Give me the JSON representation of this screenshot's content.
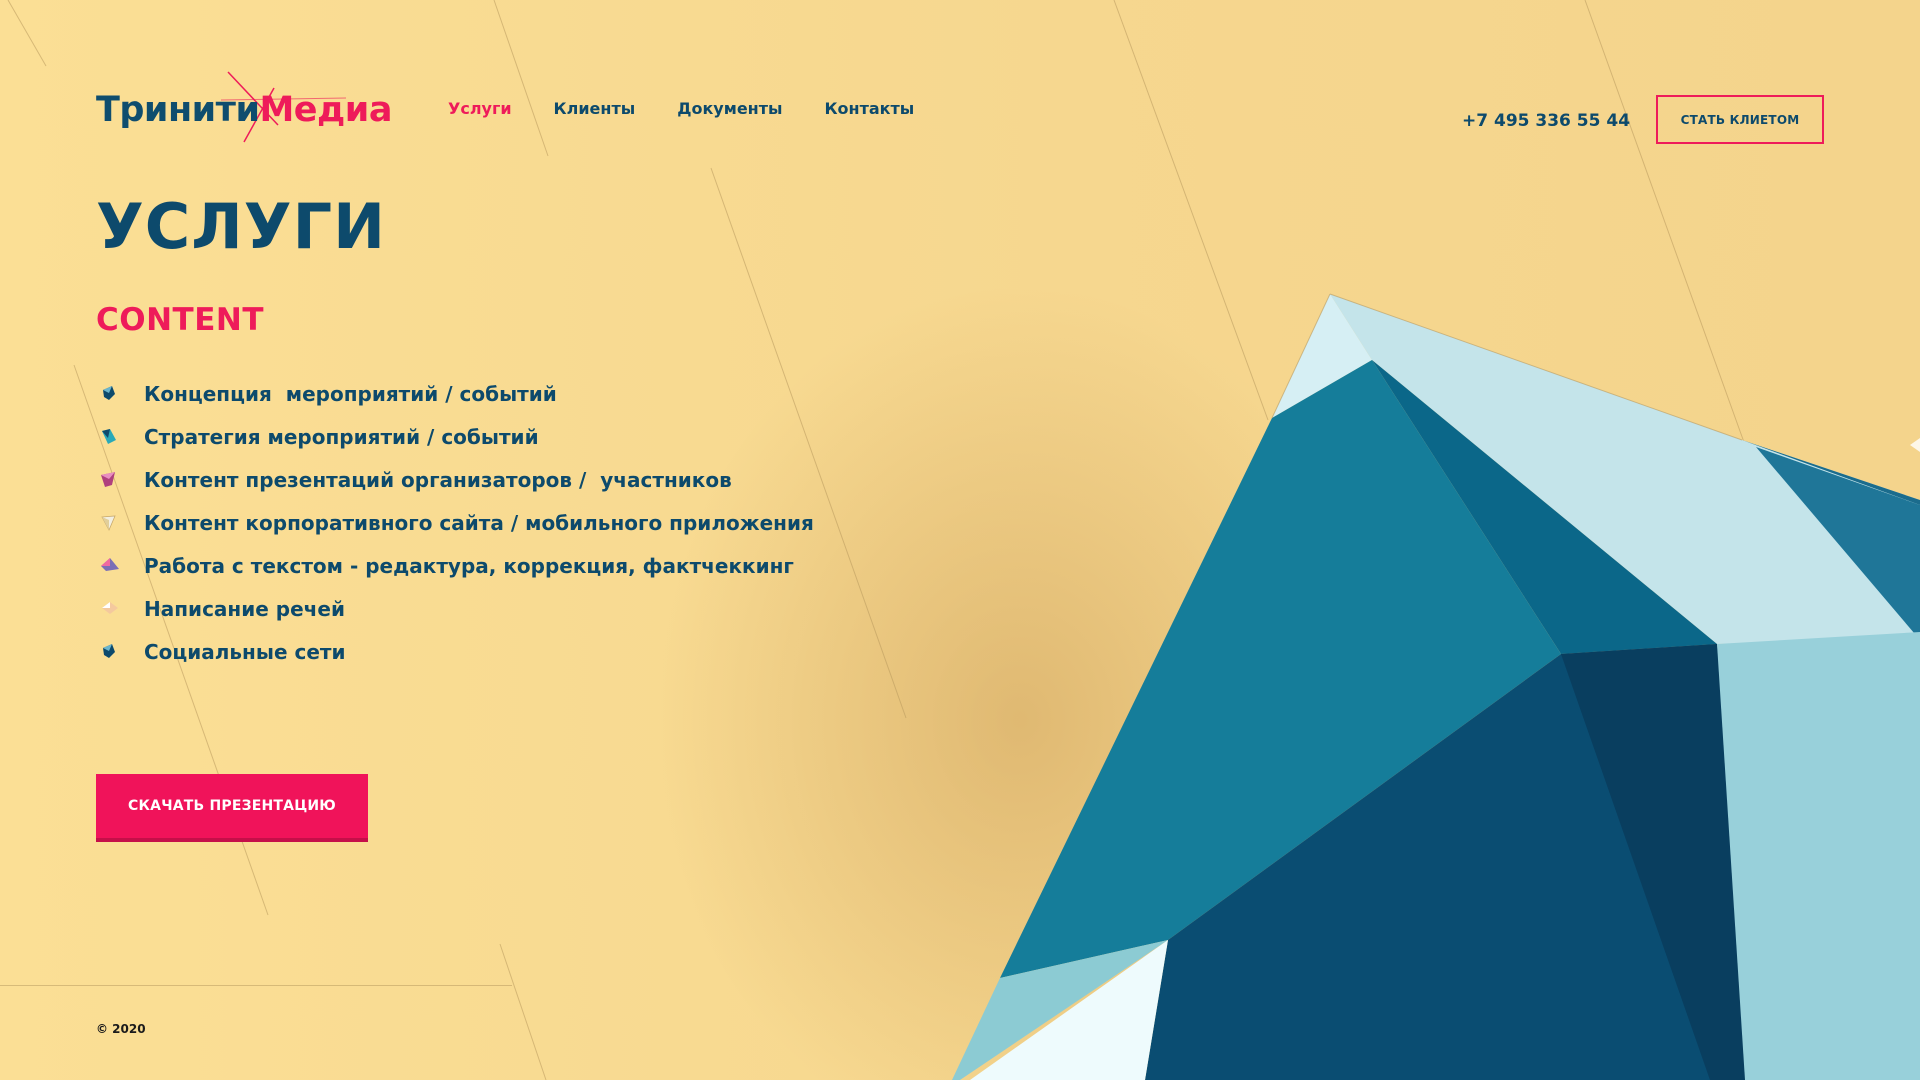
{
  "brand": {
    "name_part1": "Тринити",
    "name_part2": "Медиа",
    "primary_color": "#0d4a6c",
    "accent_color": "#ee1b5a",
    "background_color": "#f9dc93"
  },
  "nav": {
    "items": [
      {
        "label": "Услуги",
        "active": true
      },
      {
        "label": "Клиенты",
        "active": false
      },
      {
        "label": "Документы",
        "active": false
      },
      {
        "label": "Контакты",
        "active": false
      }
    ]
  },
  "header": {
    "phone": "+7 495 336 55 44",
    "cta_label": "СТАТЬ КЛИЕТОМ"
  },
  "main": {
    "title": "УСЛУГИ",
    "section_title": "CONTENT",
    "services": [
      {
        "label": "Концепция  мероприятий / событий",
        "icon": "crystal-dark-icon"
      },
      {
        "label": "Стратегия мероприятий / событий",
        "icon": "crystal-teal-icon"
      },
      {
        "label": "Контент презентаций организаторов /  участников",
        "icon": "crystal-pink-icon"
      },
      {
        "label": "Контент корпоративного сайта / мобильного приложения",
        "icon": "crystal-light-icon"
      },
      {
        "label": "Работа с текстом - редактура, коррекция, фактчеккинг",
        "icon": "crystal-violet-icon"
      },
      {
        "label": "Написание речей",
        "icon": "crystal-peach-icon"
      },
      {
        "label": "Социальные сети",
        "icon": "crystal-dark-icon"
      }
    ],
    "download_label": "СКАЧАТЬ ПРЕЗЕНТАЦИЮ"
  },
  "footer": {
    "copyright": "© 2020"
  }
}
